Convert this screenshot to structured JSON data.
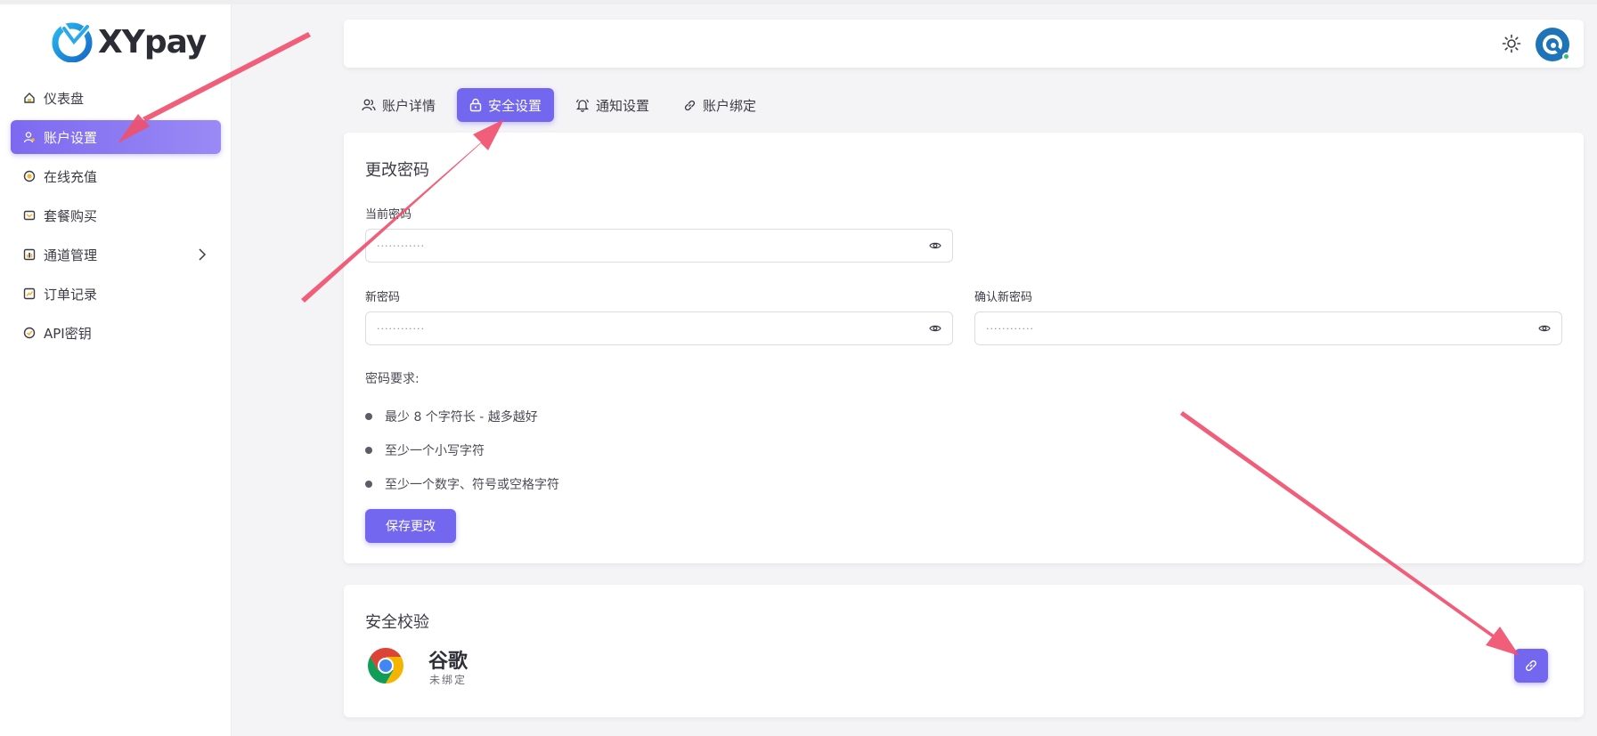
{
  "brand": {
    "name": "XYpay"
  },
  "colors": {
    "accent": "#7367f0",
    "annotation": "#f0506e",
    "online": "#28c76f"
  },
  "sidebar": {
    "items": [
      {
        "label": "仪表盘",
        "icon": "home-icon",
        "active": false
      },
      {
        "label": "账户设置",
        "icon": "user-settings-icon",
        "active": true
      },
      {
        "label": "在线充值",
        "icon": "coin-icon",
        "active": false
      },
      {
        "label": "套餐购买",
        "icon": "package-icon",
        "active": false
      },
      {
        "label": "通道管理",
        "icon": "chart-icon",
        "active": false,
        "has_submenu": true
      },
      {
        "label": "订单记录",
        "icon": "order-icon",
        "active": false
      },
      {
        "label": "API密钥",
        "icon": "key-icon",
        "active": false
      }
    ]
  },
  "header": {
    "theme_icon": "sun-icon",
    "avatar_icon": "avatar-icon"
  },
  "tabs": [
    {
      "label": "账户详情",
      "icon": "users-icon",
      "active": false
    },
    {
      "label": "安全设置",
      "icon": "lock-icon",
      "active": true
    },
    {
      "label": "通知设置",
      "icon": "bell-icon",
      "active": false
    },
    {
      "label": "账户绑定",
      "icon": "link-icon",
      "active": false
    }
  ],
  "password_card": {
    "title": "更改密码",
    "current_password": {
      "label": "当前密码",
      "value": "············"
    },
    "new_password": {
      "label": "新密码",
      "value": "············"
    },
    "confirm_password": {
      "label": "确认新密码",
      "value": "············"
    },
    "requirements_title": "密码要求:",
    "requirements": [
      "最少 8 个字符长 - 越多越好",
      "至少一个小写字符",
      "至少一个数字、符号或空格字符"
    ],
    "save_label": "保存更改"
  },
  "verify_card": {
    "title": "安全校验",
    "provider_name": "谷歌",
    "provider_status": "未绑定",
    "provider_icon": "chrome-icon",
    "bind_icon": "link-icon"
  }
}
